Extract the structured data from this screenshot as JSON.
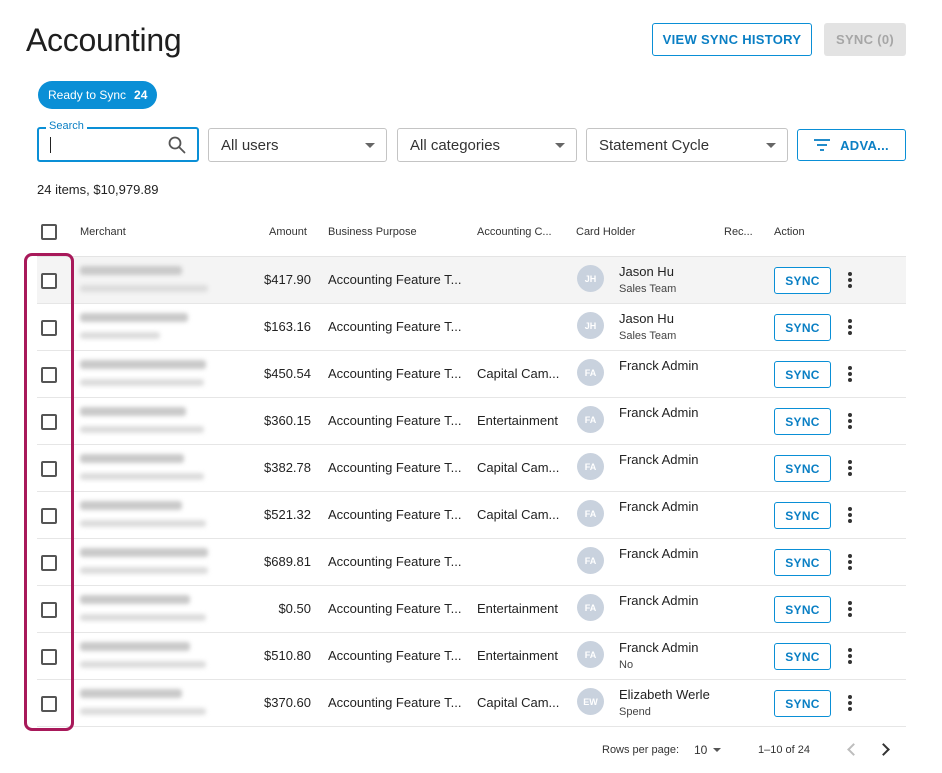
{
  "page": {
    "title": "Accounting"
  },
  "toolbar": {
    "history_label": "VIEW SYNC HISTORY",
    "sync_label": "SYNC (0)"
  },
  "chip": {
    "label": "Ready to Sync",
    "count": "24"
  },
  "search": {
    "label": "Search",
    "value": ""
  },
  "filters": {
    "users": "All users",
    "categories": "All categories",
    "statement": "Statement Cycle",
    "advanced_label": "ADVA..."
  },
  "summary": "24 items, $10,979.89",
  "columns": {
    "merchant": "Merchant",
    "amount": "Amount",
    "purpose": "Business Purpose",
    "category": "Accounting C...",
    "holder": "Card Holder",
    "receipt": "Rec...",
    "action": "Action"
  },
  "rows": [
    {
      "amount": "$417.90",
      "purpose": "Accounting Feature T...",
      "category": "",
      "initials": "JH",
      "holder": "Jason Hu",
      "holder_sub": "Sales Team",
      "sync": "SYNC"
    },
    {
      "amount": "$163.16",
      "purpose": "Accounting Feature T...",
      "category": "",
      "initials": "JH",
      "holder": "Jason Hu",
      "holder_sub": "Sales Team",
      "sync": "SYNC"
    },
    {
      "amount": "$450.54",
      "purpose": "Accounting Feature T...",
      "category": "Capital Cam...",
      "initials": "FA",
      "holder": "Franck Admin",
      "holder_sub": "",
      "sync": "SYNC"
    },
    {
      "amount": "$360.15",
      "purpose": "Accounting Feature T...",
      "category": "Entertainment",
      "initials": "FA",
      "holder": "Franck Admin",
      "holder_sub": "",
      "sync": "SYNC"
    },
    {
      "amount": "$382.78",
      "purpose": "Accounting Feature T...",
      "category": "Capital Cam...",
      "initials": "FA",
      "holder": "Franck Admin",
      "holder_sub": "",
      "sync": "SYNC"
    },
    {
      "amount": "$521.32",
      "purpose": "Accounting Feature T...",
      "category": "Capital Cam...",
      "initials": "FA",
      "holder": "Franck Admin",
      "holder_sub": "",
      "sync": "SYNC"
    },
    {
      "amount": "$689.81",
      "purpose": "Accounting Feature T...",
      "category": "",
      "initials": "FA",
      "holder": "Franck Admin",
      "holder_sub": "",
      "sync": "SYNC"
    },
    {
      "amount": "$0.50",
      "purpose": "Accounting Feature T...",
      "category": "Entertainment",
      "initials": "FA",
      "holder": "Franck Admin",
      "holder_sub": "",
      "sync": "SYNC"
    },
    {
      "amount": "$510.80",
      "purpose": "Accounting Feature T...",
      "category": "Entertainment",
      "initials": "FA",
      "holder": "Franck Admin",
      "holder_sub": "No",
      "sync": "SYNC"
    },
    {
      "amount": "$370.60",
      "purpose": "Accounting Feature T...",
      "category": "Capital Cam...",
      "initials": "EW",
      "holder": "Elizabeth Werle",
      "holder_sub": "Spend",
      "sync": "SYNC"
    }
  ],
  "pagination": {
    "rows_label": "Rows per page:",
    "rows_value": "10",
    "range": "1–10 of 24"
  },
  "icons": {
    "search": "search-icon",
    "filter": "filter-icon",
    "more": "more-vert-icon",
    "prev": "chevron-left-icon",
    "next": "chevron-right-icon",
    "dropdown": "caret-down-icon"
  },
  "colors": {
    "accent": "#0a8fd6",
    "highlight": "#a8195a",
    "disabled_bg": "#e3e3e3"
  }
}
